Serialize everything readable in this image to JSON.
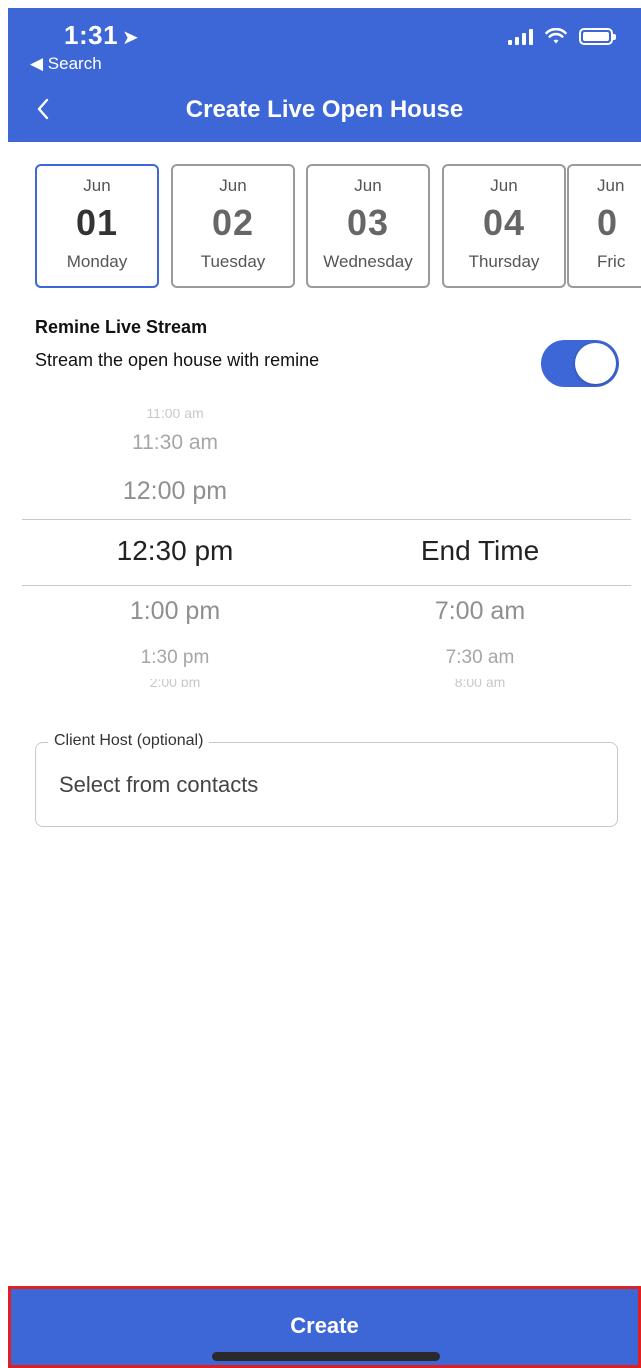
{
  "status_bar": {
    "time": "1:31",
    "location_glyph": "➤",
    "back_app": "◀ Search"
  },
  "header": {
    "title": "Create Live Open House",
    "back_icon": "chevron-left-icon"
  },
  "dates": [
    {
      "month": "Jun",
      "day": "01",
      "weekday": "Monday",
      "selected": true
    },
    {
      "month": "Jun",
      "day": "02",
      "weekday": "Tuesday",
      "selected": false
    },
    {
      "month": "Jun",
      "day": "03",
      "weekday": "Wednesday",
      "selected": false
    },
    {
      "month": "Jun",
      "day": "04",
      "weekday": "Thursday",
      "selected": false
    },
    {
      "month": "Jun",
      "day": "0",
      "weekday": "Fric",
      "selected": false
    }
  ],
  "live_stream": {
    "title": "Remine Live Stream",
    "description": "Stream the open house with remine",
    "enabled": true
  },
  "time_picker": {
    "start": {
      "above_faded": "11:00 am",
      "above2": "11:30 am",
      "above1": "12:00 pm",
      "selected": "12:30 pm",
      "below1": "1:00 pm",
      "below2": "1:30 pm",
      "below_faded": "2:00 pm"
    },
    "end": {
      "selected": "End Time",
      "below1": "7:00 am",
      "below2": "7:30 am",
      "below_faded": "8:00 am"
    }
  },
  "client_host": {
    "label": "Client Host (optional)",
    "placeholder": "Select from contacts"
  },
  "create_button": {
    "label": "Create"
  },
  "colors": {
    "accent": "#3d66d6",
    "highlight_border": "#e02020"
  }
}
